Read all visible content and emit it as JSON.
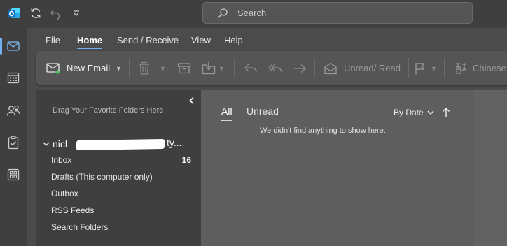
{
  "titlebar": {
    "search_placeholder": "Search"
  },
  "menu": {
    "tabs": [
      {
        "label": "File",
        "active": false
      },
      {
        "label": "Home",
        "active": true
      },
      {
        "label": "Send / Receive",
        "active": false
      },
      {
        "label": "View",
        "active": false
      },
      {
        "label": "Help",
        "active": false
      }
    ]
  },
  "ribbon": {
    "new_email_label": "New Email",
    "unread_read_label": "Unread/ Read",
    "chinese_label": "Chinese"
  },
  "folder_pane": {
    "drag_hint": "Drag Your Favorite Folders Here",
    "account_prefix": "nicl",
    "account_suffix": "ty....",
    "folders": [
      {
        "name": "Inbox",
        "count": "16"
      },
      {
        "name": "Drafts (This computer only)",
        "count": ""
      },
      {
        "name": "Outbox",
        "count": ""
      },
      {
        "name": "RSS Feeds",
        "count": ""
      },
      {
        "name": "Search Folders",
        "count": ""
      }
    ]
  },
  "message_list": {
    "tab_all": "All",
    "tab_unread": "Unread",
    "sort_label": "By Date",
    "empty_message": "We didn't find anything to show here."
  },
  "colors": {
    "accent": "#6fb1f0",
    "outlook_brand": "#0f6cbd",
    "background": "#4b4b4b",
    "pane_dark": "#3f3f3f"
  }
}
